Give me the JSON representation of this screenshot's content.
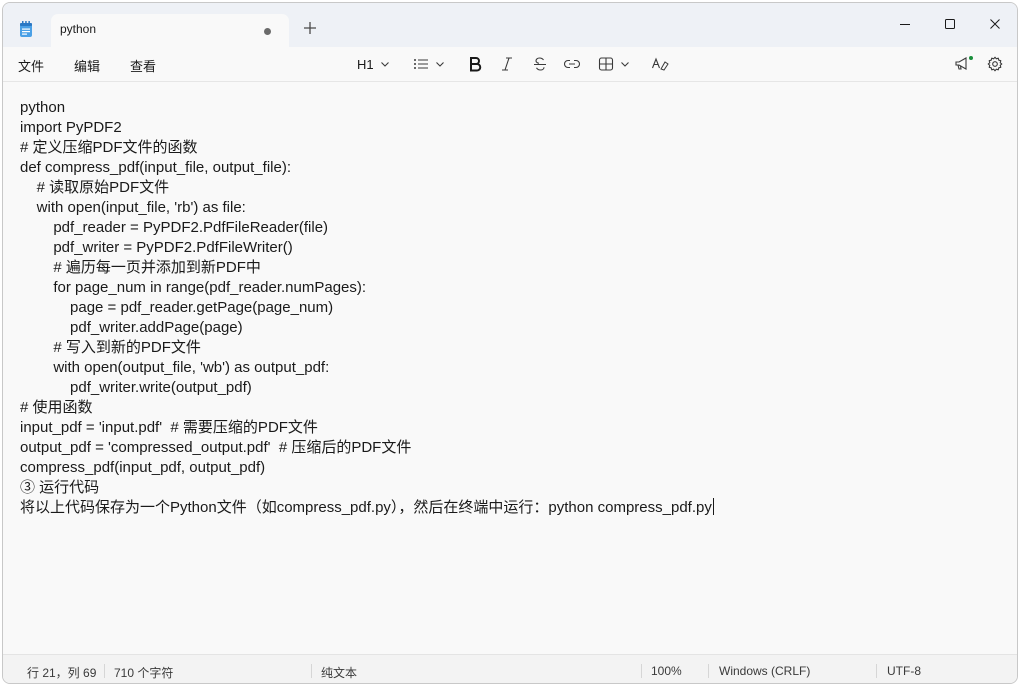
{
  "tab": {
    "title": "python"
  },
  "menu": {
    "file": "文件",
    "edit": "编辑",
    "view": "查看"
  },
  "toolbar": {
    "heading": "H1",
    "icons": [
      "heading-dropdown",
      "list-icon",
      "bold-icon",
      "italic-icon",
      "strikethrough-icon",
      "link-icon",
      "table-icon",
      "clear-format-icon",
      "whats-new-icon",
      "gear-icon"
    ]
  },
  "editor": {
    "lines": [
      "python",
      "import PyPDF2",
      "# 定义压缩PDF文件的函数",
      "def compress_pdf(input_file, output_file):",
      "    # 读取原始PDF文件",
      "    with open(input_file, 'rb') as file:",
      "        pdf_reader = PyPDF2.PdfFileReader(file)",
      "        pdf_writer = PyPDF2.PdfFileWriter()",
      "        # 遍历每一页并添加到新PDF中",
      "        for page_num in range(pdf_reader.numPages):",
      "            page = pdf_reader.getPage(page_num)",
      "            pdf_writer.addPage(page)",
      "        # 写入到新的PDF文件",
      "        with open(output_file, 'wb') as output_pdf:",
      "            pdf_writer.write(output_pdf)",
      "# 使用函数",
      "input_pdf = 'input.pdf'  # 需要压缩的PDF文件",
      "output_pdf = 'compressed_output.pdf'  # 压缩后的PDF文件",
      "compress_pdf(input_pdf, output_pdf)",
      "③ 运行代码",
      "将以上代码保存为一个Python文件（如compress_pdf.py），然后在终端中运行：python compress_pdf.py"
    ]
  },
  "status": {
    "position": "行 21，列 69",
    "chars": "710 个字符",
    "format": "纯文本",
    "zoom": "100%",
    "line_ending": "Windows (CRLF)",
    "encoding": "UTF-8"
  },
  "colors": {
    "accent": "#0067c0",
    "badge": "#1a8f3c"
  }
}
